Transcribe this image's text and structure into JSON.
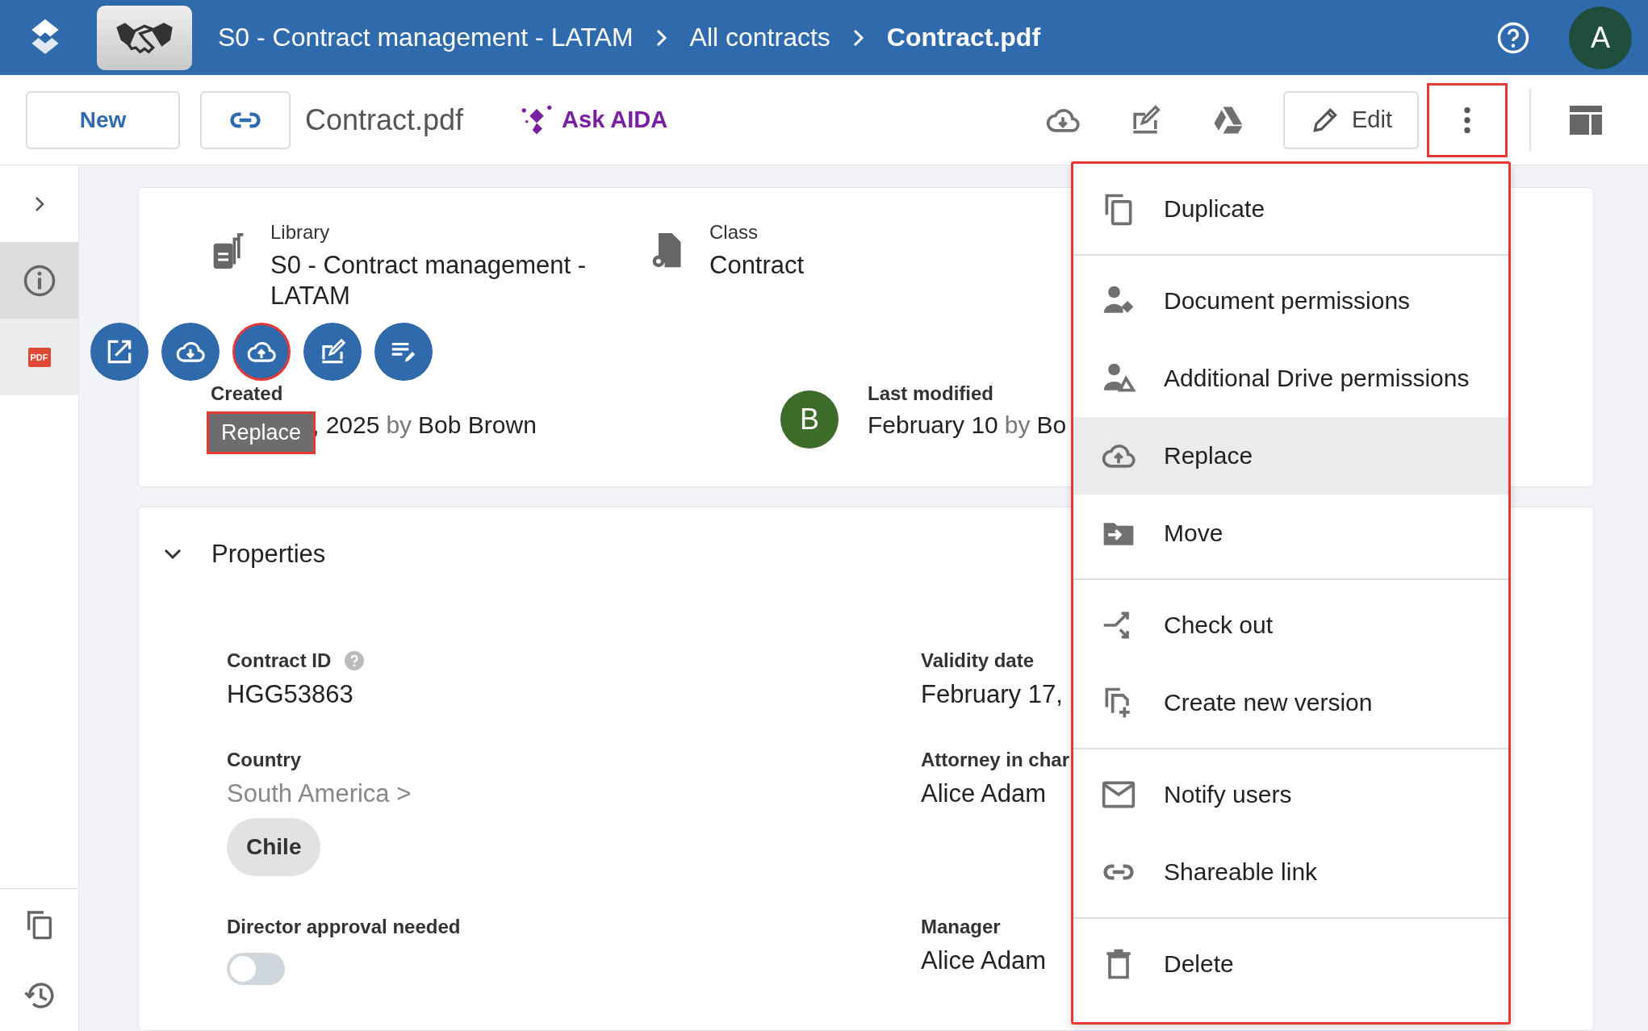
{
  "header": {
    "breadcrumb": [
      {
        "label": "S0 - Contract management - LATAM",
        "current": false
      },
      {
        "label": "All contracts",
        "current": false
      },
      {
        "label": "Contract.pdf",
        "current": true
      }
    ],
    "avatar": "A"
  },
  "toolbar": {
    "new_button": "New",
    "file_name": "Contract.pdf",
    "ask_button": "Ask AIDA",
    "edit_button": "Edit",
    "more_highlighted": true
  },
  "sidebar": {
    "items": [
      {
        "kind": "info",
        "selected": true
      },
      {
        "kind": "pdf",
        "label": "PDF",
        "selected": false
      }
    ]
  },
  "summary": {
    "library": {
      "label": "Library",
      "value": "S0 - Contract management - LATAM"
    },
    "class": {
      "label": "Class",
      "value": "Contract"
    },
    "actions": [
      {
        "highlighted": false
      },
      {
        "highlighted": false
      },
      {
        "highlighted": true
      },
      {
        "highlighted": false
      },
      {
        "highlighted": false
      }
    ],
    "tooltip": {
      "label": "Replace",
      "highlighted": true
    },
    "created": {
      "label": "Created",
      "date": ", 2025",
      "by": "by",
      "author": "Bob Brown"
    },
    "last_modified": {
      "label": "Last modified",
      "avatar": "B",
      "date": "February 10",
      "by": "by",
      "author": "Bo"
    }
  },
  "properties": {
    "title": "Properties",
    "expanded": true,
    "fields": [
      {
        "kind": "text",
        "label": "Contract ID",
        "help": true,
        "value": "HGG53863"
      },
      {
        "kind": "text",
        "label": "Validity date",
        "value": "February 17,"
      },
      {
        "kind": "tree",
        "label": "Country",
        "path": "South America >",
        "chip": "Chile"
      },
      {
        "kind": "text",
        "label": "Attorney in char",
        "value": "Alice Adam"
      },
      {
        "kind": "toggle",
        "label": "Director approval needed",
        "on": false
      },
      {
        "kind": "text",
        "label": "Manager",
        "value": "Alice Adam"
      }
    ]
  },
  "menu": {
    "highlighted": true,
    "groups": [
      {
        "items": [
          {
            "label": "Duplicate",
            "highlighted": false
          }
        ]
      },
      {
        "items": [
          {
            "label": "Document permissions",
            "highlighted": false
          },
          {
            "label": "Additional Drive permissions",
            "highlighted": false
          },
          {
            "label": "Replace",
            "highlighted": true
          },
          {
            "label": "Move",
            "highlighted": false
          }
        ]
      },
      {
        "items": [
          {
            "label": "Check out",
            "highlighted": false
          },
          {
            "label": "Create new version",
            "highlighted": false
          }
        ]
      },
      {
        "items": [
          {
            "label": "Notify users",
            "highlighted": false
          },
          {
            "label": "Shareable link",
            "highlighted": false
          }
        ]
      },
      {
        "items": [
          {
            "label": "Delete",
            "highlighted": false
          }
        ]
      }
    ]
  }
}
